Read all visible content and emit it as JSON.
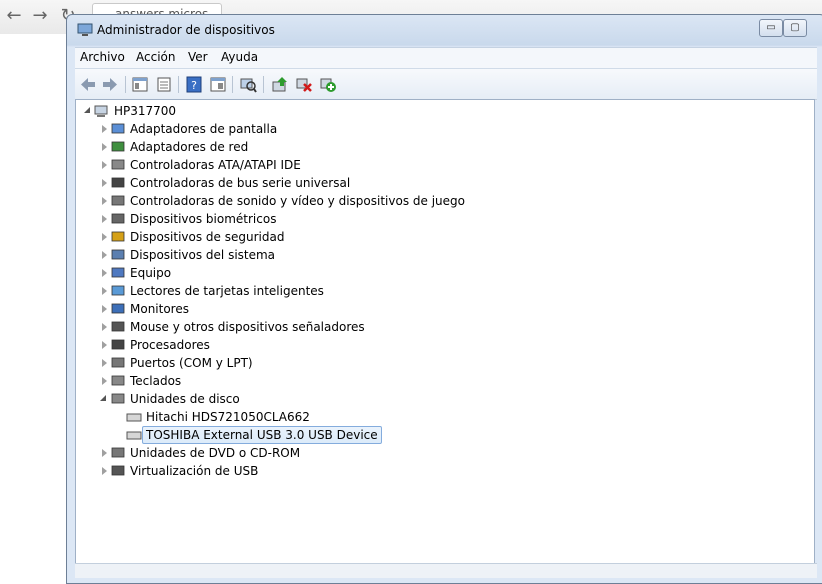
{
  "window": {
    "title": "Administrador de dispositivos",
    "minimize": "▭",
    "maximize": "▢"
  },
  "menu": [
    "Archivo",
    "Acción",
    "Ver",
    "Ayuda"
  ],
  "toolbar_icons": [
    "back-arrow-icon",
    "forward-arrow-icon",
    "console-tree-icon",
    "properties-icon",
    "help-icon",
    "view-icon",
    "scan-hardware-icon",
    "update-driver-icon",
    "uninstall-icon",
    "enable-device-icon"
  ],
  "tree": {
    "root": "HP317700",
    "categories": [
      {
        "label": "Adaptadores de pantalla",
        "icon": "display-adapter-icon",
        "expanded": false
      },
      {
        "label": "Adaptadores de red",
        "icon": "network-adapter-icon",
        "expanded": false
      },
      {
        "label": "Controladoras ATA/ATAPI IDE",
        "icon": "ide-controller-icon",
        "expanded": false
      },
      {
        "label": "Controladoras de bus serie universal",
        "icon": "usb-controller-icon",
        "expanded": false
      },
      {
        "label": "Controladoras de sonido y vídeo y dispositivos de juego",
        "icon": "sound-icon",
        "expanded": false
      },
      {
        "label": "Dispositivos biométricos",
        "icon": "biometric-icon",
        "expanded": false
      },
      {
        "label": "Dispositivos de seguridad",
        "icon": "security-key-icon",
        "expanded": false
      },
      {
        "label": "Dispositivos del sistema",
        "icon": "system-device-icon",
        "expanded": false
      },
      {
        "label": "Equipo",
        "icon": "computer-icon",
        "expanded": false
      },
      {
        "label": "Lectores de tarjetas inteligentes",
        "icon": "smart-card-icon",
        "expanded": false
      },
      {
        "label": "Monitores",
        "icon": "monitor-icon",
        "expanded": false
      },
      {
        "label": "Mouse y otros dispositivos señaladores",
        "icon": "mouse-icon",
        "expanded": false
      },
      {
        "label": "Procesadores",
        "icon": "processor-icon",
        "expanded": false
      },
      {
        "label": "Puertos (COM y LPT)",
        "icon": "port-icon",
        "expanded": false
      },
      {
        "label": "Teclados",
        "icon": "keyboard-icon",
        "expanded": false
      },
      {
        "label": "Unidades de disco",
        "icon": "disk-drive-icon",
        "expanded": true,
        "children": [
          {
            "label": "Hitachi HDS721050CLA662",
            "icon": "disk-drive-icon",
            "selected": false
          },
          {
            "label": "TOSHIBA External USB 3.0 USB Device",
            "icon": "usb-disk-icon",
            "selected": true
          }
        ]
      },
      {
        "label": "Unidades de DVD o CD-ROM",
        "icon": "dvd-drive-icon",
        "expanded": false
      },
      {
        "label": "Virtualización de USB",
        "icon": "usb-virtual-icon",
        "expanded": false
      }
    ]
  },
  "browser": {
    "tab_text": "answers.micros"
  }
}
